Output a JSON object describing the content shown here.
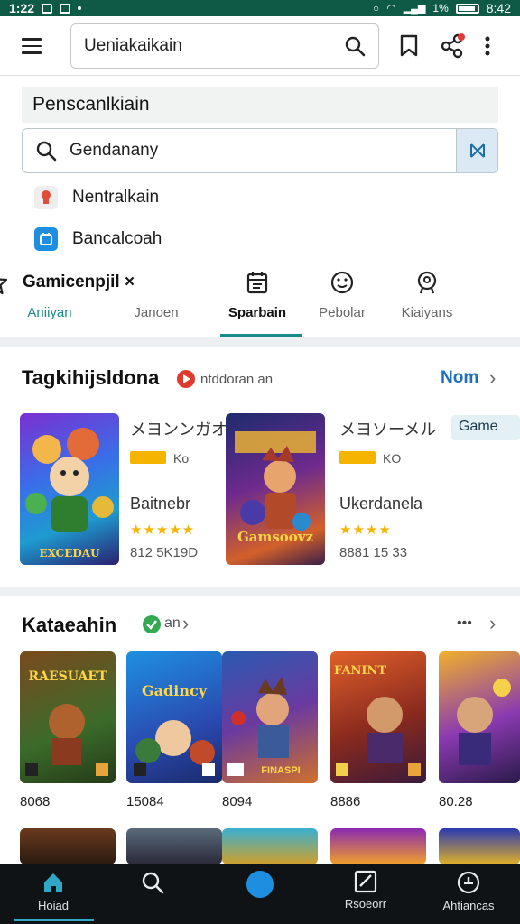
{
  "status_bar": {
    "time": "1:22",
    "battery_text": "1%",
    "clock_right": "8:42"
  },
  "app_bar": {
    "search_value": "Ueniakaikain"
  },
  "panel": {
    "title": "Penscanlkiain",
    "search_value": "Gendanany",
    "suggestions": [
      {
        "label": "Nentralkain",
        "icon": "app-red-icon"
      },
      {
        "label": "Bancalcoah",
        "icon": "app-blue-icon"
      }
    ]
  },
  "tabs": [
    {
      "label": "Aniiyan",
      "title": "Gamicenpjil ×",
      "icon": "star-icon"
    },
    {
      "label": "Janoen",
      "icon": ""
    },
    {
      "label": "Sparbain",
      "icon": "calendar-icon"
    },
    {
      "label": "Pebolar",
      "icon": "smile-icon"
    },
    {
      "label": "Kiaiyans",
      "icon": "badge-icon"
    }
  ],
  "section1": {
    "title": "Tagkihijsldona",
    "subtitle": "ntddoran an",
    "more": "Nom",
    "chip": "Game",
    "cards": [
      {
        "jp_title": "メヨンンガオ",
        "rating_tag": "Ko",
        "name": "Baitnebr",
        "stars": "★★★★★",
        "price": "812 5K19D",
        "art_text": "EXCEDAU"
      },
      {
        "jp_title": "メヨソーメル",
        "rating_tag": "KO",
        "name": "Ukerdanela",
        "stars": "★★★★",
        "price": "8881 15 33",
        "art_text": "Gamsoovz"
      }
    ]
  },
  "section2": {
    "title": "Kataeahin",
    "badge_text": "an",
    "more_dots": "•••",
    "tiles": [
      {
        "price": "8068",
        "art_text": "RAESUAET"
      },
      {
        "price": "15084",
        "art_text": "Gadincy"
      },
      {
        "price": "8094",
        "art_text": "FINASPI"
      },
      {
        "price": "8886",
        "art_text": "FANINT"
      },
      {
        "price": "80.28",
        "art_text": ""
      }
    ]
  },
  "bottom_nav": [
    {
      "label": "Hoiad",
      "icon": "home-icon"
    },
    {
      "label": "",
      "icon": "search-icon"
    },
    {
      "label": "",
      "icon": "circle-icon"
    },
    {
      "label": "Rsoeorr",
      "icon": "edit-icon"
    },
    {
      "label": "Ahtiancas",
      "icon": "info-icon"
    }
  ],
  "colors": {
    "status_bar": "#0f5a47",
    "accent": "#1a8a8a",
    "link": "#1f6fb8",
    "bottom_nav": "#0f1315",
    "blue_dot": "#1e8fe0"
  }
}
